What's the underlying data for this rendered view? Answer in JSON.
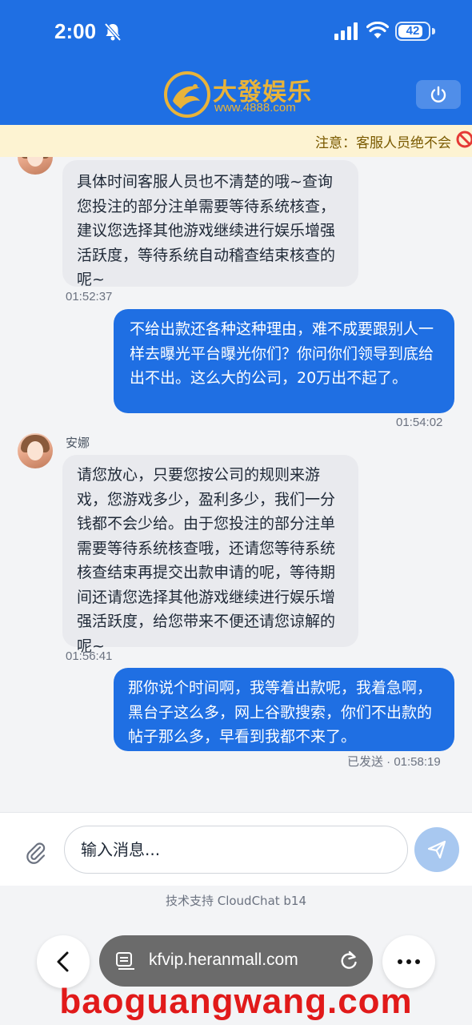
{
  "status_bar": {
    "time": "2:00",
    "battery": "42"
  },
  "header": {
    "brand_name": "大發娱乐",
    "brand_url": "www.4888.com"
  },
  "notice": {
    "text": "注意：客服人员绝不会"
  },
  "messages": [
    {
      "id": "m1",
      "direction": "in",
      "text": "具体时间客服人员也不清楚的哦~查询您投注的部分注单需要等待系统核查，建议您选择其他游戏继续进行娱乐增强活跃度，等待系统自动稽查结束核查的呢~",
      "timestamp": "01:52:37"
    },
    {
      "id": "m2",
      "direction": "out",
      "text": "不给出款还各种这种理由，难不成要跟别人一样去曝光平台曝光你们？你问你们领导到底给出不出。这么大的公司，20万出不起了。",
      "timestamp": "01:54:02"
    },
    {
      "id": "m3",
      "direction": "in",
      "sender": "安娜",
      "text": "请您放心，只要您按公司的规则来游戏，您游戏多少，盈利多少，我们一分钱都不会少给。由于您投注的部分注单需要等待系统核查哦，还请您等待系统核查结束再提交出款申请的呢，等待期间还请您选择其他游戏继续进行娱乐增强活跃度，给您带来不便还请您谅解的呢~",
      "timestamp": "01:56:41"
    },
    {
      "id": "m4",
      "direction": "out",
      "text": "那你说个时间啊，我等着出款呢，我着急啊，黑台子这么多，网上谷歌搜索，你们不出款的帖子那么多，早看到我都不来了。",
      "timestamp": "已发送 · 01:58:19"
    }
  ],
  "composer": {
    "placeholder": "输入消息..."
  },
  "footer": {
    "powered_by": "技术支持 CloudChat b14"
  },
  "browser": {
    "url": "kfvip.heranmall.com"
  },
  "watermark": "baoguangwang.com",
  "colors": {
    "primary": "#1f6fe3",
    "notice_bg": "#fdf3d2",
    "brand_gold": "#e8b33a",
    "watermark": "#e11a1a"
  }
}
